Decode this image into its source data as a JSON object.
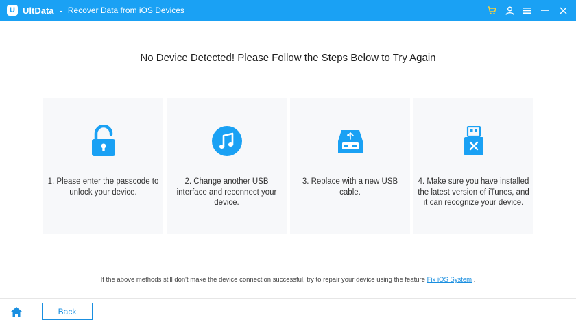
{
  "titlebar": {
    "app_name": "UltData",
    "separator": "-",
    "window_title": "Recover Data from iOS Devices",
    "logo_letter": "U",
    "controls": [
      "cart-icon",
      "user-icon",
      "menu-icon",
      "minimize-icon",
      "close-icon"
    ]
  },
  "main": {
    "heading": "No Device Detected! Please Follow the Steps Below to Try Again",
    "steps": [
      {
        "icon": "unlock-icon",
        "text": "1. Please enter the passcode to unlock your device."
      },
      {
        "icon": "itunes-music-icon",
        "text": "2. Change another USB interface and reconnect your device."
      },
      {
        "icon": "usb-port-icon",
        "text": "3. Replace with a new USB cable."
      },
      {
        "icon": "usb-error-icon",
        "text": "4. Make sure you have installed the latest version of iTunes, and it can recognize your device."
      }
    ],
    "footnote_prefix": "If the above methods still don't make the device connection successful, try to repair your device using the feature",
    "footnote_link": "Fix iOS System",
    "footnote_suffix": "."
  },
  "bottombar": {
    "home_icon": "home-icon",
    "back_label": "Back"
  },
  "colors": {
    "accent": "#1aa1f4",
    "link": "#1a8fe0",
    "card_bg": "#f7f8fa"
  }
}
